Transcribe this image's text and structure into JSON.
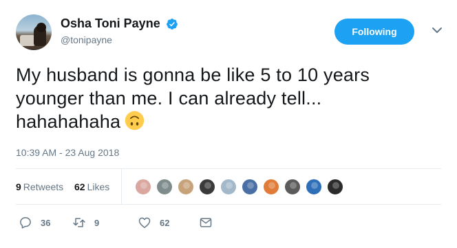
{
  "user": {
    "display_name": "Osha Toni Payne",
    "handle": "@tonipayne",
    "verified_color": "#1da1f2"
  },
  "follow_button": {
    "label": "Following",
    "color": "#1da1f2"
  },
  "tweet": {
    "text_lines": [
      "My husband is gonna be like 5 to 10 years",
      "younger than me. I can already tell...",
      "hahahahaha"
    ],
    "emoji": "upside-down-face",
    "timestamp": "10:39 AM - 23 Aug 2018"
  },
  "stats": {
    "retweets_count": "9",
    "retweets_label": "Retweets",
    "likes_count": "62",
    "likes_label": "Likes"
  },
  "likers": [
    {
      "name": "liker-avatar-1",
      "color": "#d9a7a0"
    },
    {
      "name": "liker-avatar-2",
      "color": "#7f8c8d"
    },
    {
      "name": "liker-avatar-3",
      "color": "#c8a27a"
    },
    {
      "name": "liker-avatar-4",
      "color": "#3a3a3a"
    },
    {
      "name": "liker-avatar-5",
      "color": "#a3b8c9"
    },
    {
      "name": "liker-avatar-6",
      "color": "#4a6fa5"
    },
    {
      "name": "liker-avatar-7",
      "color": "#e07b39"
    },
    {
      "name": "liker-avatar-8",
      "color": "#5b5b5b"
    },
    {
      "name": "liker-avatar-9",
      "color": "#2e6fb7"
    },
    {
      "name": "liker-avatar-10",
      "color": "#2b2b2b"
    }
  ],
  "actions": {
    "reply_icon": "reply-icon",
    "reply_count": "36",
    "retweet_icon": "retweet-icon",
    "retweet_count": "9",
    "like_icon": "heart-icon",
    "like_count": "62",
    "message_icon": "envelope-icon"
  }
}
